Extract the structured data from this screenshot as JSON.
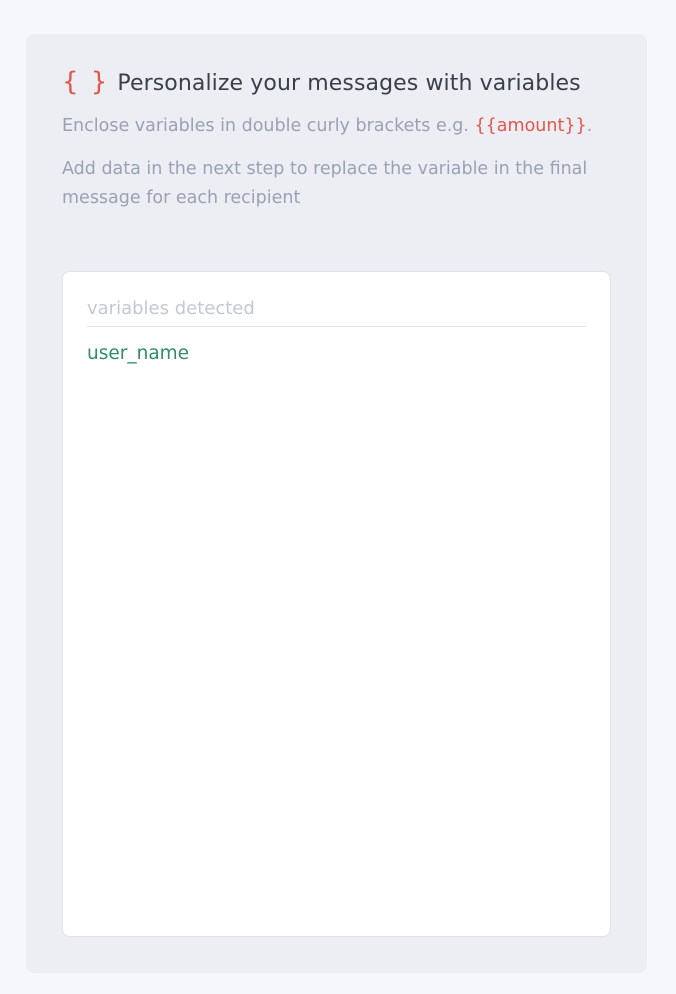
{
  "header": {
    "brace_icon_text": "{ }",
    "title": "Personalize your messages with variables"
  },
  "description": {
    "line1_prefix": "Enclose variables in double curly brackets e.g.",
    "example": "{{amount}}",
    "line1_suffix": ".",
    "line2": "Add data in the next step to replace the variable in the final message for each recipient"
  },
  "variables_panel": {
    "label": "variables detected",
    "items": [
      "user_name"
    ]
  },
  "colors": {
    "accent": "#e2574c",
    "variable": "#2f8f63"
  }
}
